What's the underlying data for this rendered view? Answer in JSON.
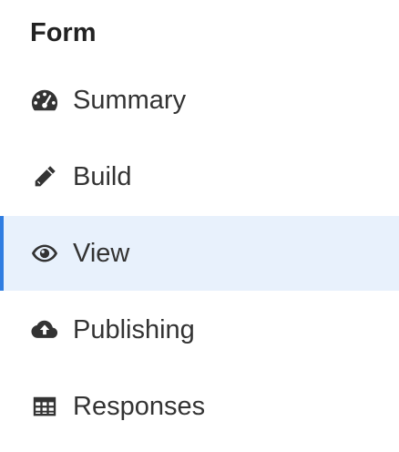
{
  "section": {
    "title": "Form"
  },
  "nav": {
    "items": [
      {
        "label": "Summary",
        "icon": "tachometer-icon"
      },
      {
        "label": "Build",
        "icon": "pencil-icon"
      },
      {
        "label": "View",
        "icon": "eye-icon",
        "active": true
      },
      {
        "label": "Publishing",
        "icon": "cloud-upload-icon"
      },
      {
        "label": "Responses",
        "icon": "table-icon"
      }
    ]
  },
  "colors": {
    "active_background": "#e8f1fc",
    "active_border": "#2f7de1",
    "text": "#333333"
  }
}
